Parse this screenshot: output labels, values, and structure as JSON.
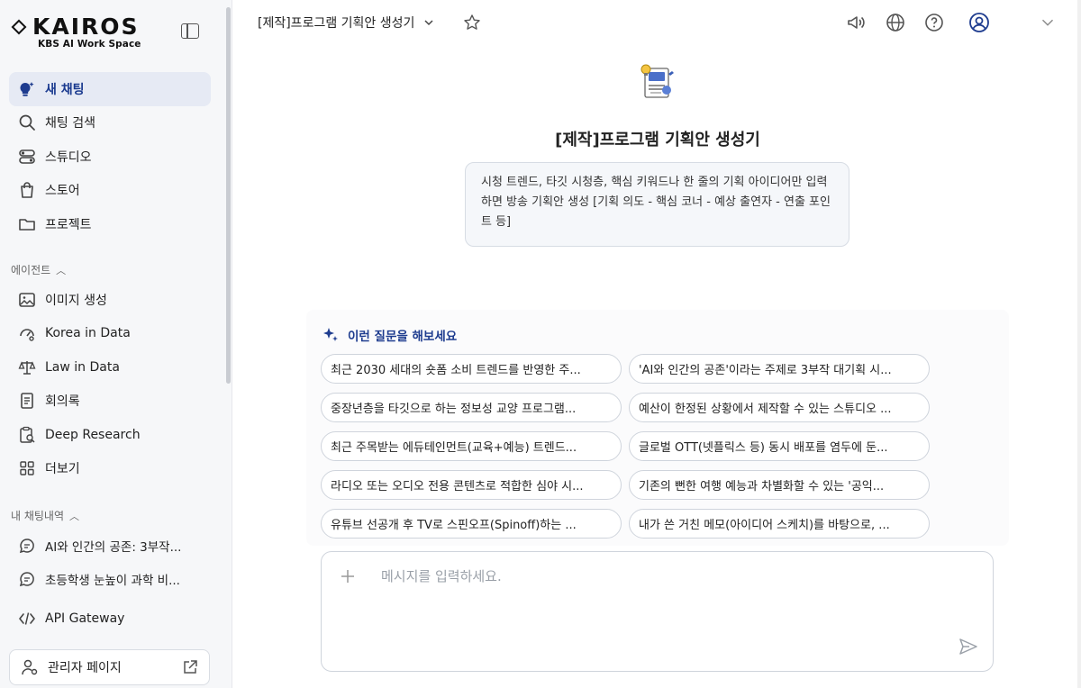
{
  "brand": {
    "name": "KAIROS",
    "subtitle": "KBS AI Work Space"
  },
  "nav": {
    "items": [
      {
        "label": "새 채팅",
        "icon": "bulb-spark-icon",
        "active": true
      },
      {
        "label": "채팅 검색",
        "icon": "search-icon"
      },
      {
        "label": "스튜디오",
        "icon": "toggle-icon"
      },
      {
        "label": "스토어",
        "icon": "bag-icon"
      },
      {
        "label": "프로젝트",
        "icon": "folder-icon"
      }
    ]
  },
  "agents": {
    "title": "에이전트",
    "items": [
      {
        "label": "이미지 생성",
        "icon": "image-icon"
      },
      {
        "label": "Korea in Data",
        "icon": "gauge-icon"
      },
      {
        "label": "Law in Data",
        "icon": "scale-icon"
      },
      {
        "label": "회의록",
        "icon": "document-icon"
      },
      {
        "label": "Deep Research",
        "icon": "clipboard-search-icon"
      },
      {
        "label": "더보기",
        "icon": "grid-icon"
      }
    ]
  },
  "history": {
    "title": "내 채팅내역",
    "items": [
      {
        "label": "AI와 인간의 공존: 3부작..."
      },
      {
        "label": "초등학생 눈높이 과학 비..."
      }
    ]
  },
  "api": {
    "label": "API Gateway"
  },
  "admin": {
    "label": "관리자 페이지"
  },
  "header": {
    "title": "[제작]프로그램 기획안 생성기"
  },
  "agent": {
    "title": "[제작]프로그램 기획안 생성기",
    "description": "시청 트렌드, 타깃 시청층, 핵심 키워드나 한 줄의 기획 아이디어만 입력하면 방송 기획안 생성 [기획 의도 - 핵심 코너 - 예상 출연자 - 연출 포인트 등]"
  },
  "suggestions": {
    "title": "이런 질문을 해보세요",
    "left": [
      "최근 2030 세대의 숏폼 소비 트렌드를 반영한 주...",
      "중장년층을 타깃으로 하는 정보성 교양 프로그램...",
      "최근 주목받는 에듀테인먼트(교육+예능) 트렌드...",
      "라디오 또는 오디오 전용 콘텐츠로 적합한 심야 시...",
      "유튜브 선공개 후 TV로 스핀오프(Spinoff)하는 ..."
    ],
    "right": [
      "'AI와 인간의 공존'이라는 주제로 3부작 대기획 시...",
      "예산이 한정된 상황에서 제작할 수 있는 스튜디오 ...",
      "글로벌 OTT(넷플릭스 등) 동시 배포를 염두에 둔...",
      "기존의 뻔한 여행 예능과 차별화할 수 있는 '공익...",
      "내가 쓴 거친 메모(아이디어 스케치)를 바탕으로, ..."
    ]
  },
  "composer": {
    "placeholder": "메시지를 입력하세요.",
    "value": ""
  },
  "colors": {
    "accent": "#1e3c8f",
    "active_bg": "#e6eaf4"
  }
}
